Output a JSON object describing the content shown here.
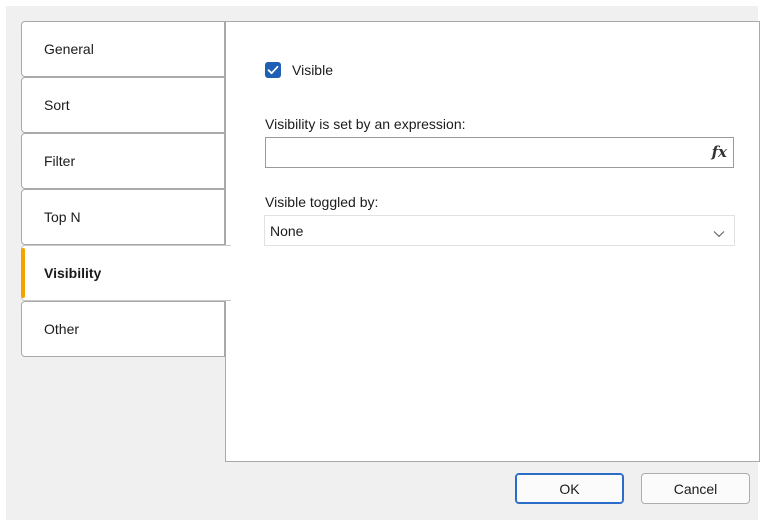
{
  "tabs": [
    {
      "label": "General",
      "active": false
    },
    {
      "label": "Sort",
      "active": false
    },
    {
      "label": "Filter",
      "active": false
    },
    {
      "label": "Top N",
      "active": false
    },
    {
      "label": "Visibility",
      "active": true
    },
    {
      "label": "Other",
      "active": false
    }
  ],
  "visibility": {
    "visible_label": "Visible",
    "visible_checked": true,
    "expression_label": "Visibility is set by an expression:",
    "expression_value": "",
    "expression_button": "fx",
    "toggled_label": "Visible toggled by:",
    "toggled_value": "None"
  },
  "buttons": {
    "ok": "OK",
    "cancel": "Cancel"
  },
  "colors": {
    "accent": "#f5a100",
    "checkbox": "#1f5fb4",
    "default_button_border": "#2b6cc8"
  }
}
